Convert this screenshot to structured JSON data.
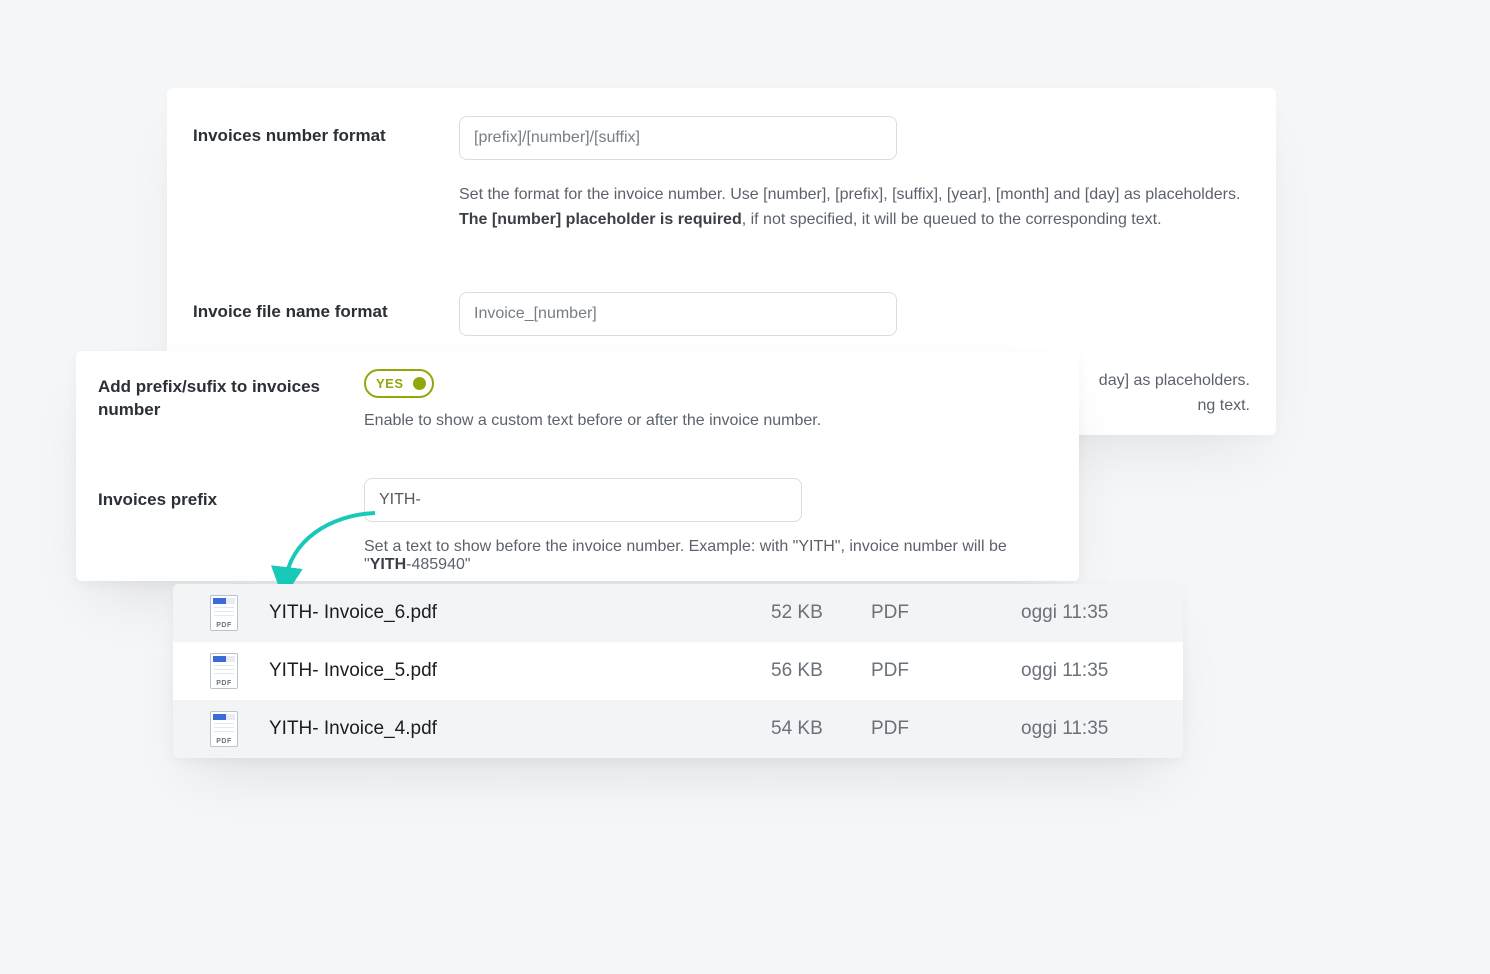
{
  "upper": {
    "row1": {
      "label": "Invoices number format",
      "value": "[prefix]/[number]/[suffix]",
      "help_a": "Set the format for the invoice number. Use [number], [prefix], [suffix], [year], [month] and [day] as placeholders. ",
      "help_b": "The [number] placeholder is required",
      "help_c": ", if not specified, it will be queued to the corresponding text."
    },
    "row2": {
      "label": "Invoice file name format",
      "value": "Invoice_[number]",
      "help_peek_a": "day] as placeholders.",
      "help_peek_b": "ng text."
    }
  },
  "lower": {
    "row1": {
      "label": "Add prefix/sufix to invoices number",
      "toggle_text": "YES",
      "help": "Enable to show a custom text before or after the invoice number."
    },
    "row2": {
      "label": "Invoices prefix",
      "value": "YITH-",
      "help_a": "Set a text to show before the invoice number. Example: with \"YITH\", invoice number will be \"",
      "help_b": "YITH",
      "help_c": "-485940\""
    }
  },
  "files": [
    {
      "name": "YITH- Invoice_6.pdf",
      "size": "52 KB",
      "kind": "PDF",
      "date": "oggi 11:35"
    },
    {
      "name": "YITH- Invoice_5.pdf",
      "size": "56 KB",
      "kind": "PDF",
      "date": "oggi 11:35"
    },
    {
      "name": "YITH- Invoice_4.pdf",
      "size": "54 KB",
      "kind": "PDF",
      "date": "oggi 11:35"
    }
  ]
}
